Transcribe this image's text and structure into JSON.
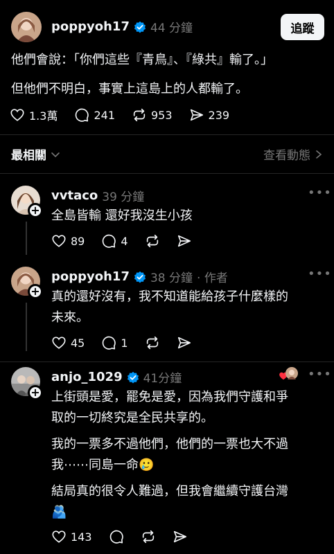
{
  "post": {
    "username": "poppyoh17",
    "time": "44 分鐘",
    "follow_label": "追蹤",
    "lines": [
      "他們會說：「你們這些『青鳥』、『綠共』輸了。」",
      "但他們不明白，事實上這島上的人都輸了。"
    ],
    "likes": "1.3萬",
    "comments": "241",
    "reposts": "953",
    "shares": "239"
  },
  "sort": {
    "label": "最相關",
    "activity_label": "查看動態"
  },
  "replies": [
    {
      "username": "vvtaco",
      "time": "39 分鐘",
      "lines": [
        "全島皆輸 還好我沒生小孩"
      ],
      "likes": "89",
      "comments": "4"
    },
    {
      "username": "poppyoh17",
      "time": "38 分鐘",
      "author_tag": "· 作者",
      "lines": [
        "真的還好沒有，我不知道能給孩子什麼樣的",
        "未來。"
      ],
      "likes": "45",
      "comments": "1"
    },
    {
      "username": "anjo_1029",
      "time": "41分鐘",
      "lines": [
        "上街頭是愛，罷免是愛，因為我們守護和爭",
        "取的一切終究是全民共享的。",
        "我的一票多不過他們，他們的一票也大不過",
        "我⋯⋯同島一命🥲",
        "結局真的很令人難過，但我會繼續守護台灣",
        "🫂"
      ],
      "likes": "143"
    }
  ],
  "colors": {
    "background": "#000000",
    "text": "#f3f5f7",
    "muted": "#777777",
    "verified": "#0095f6",
    "heart_red": "#ff3040"
  }
}
